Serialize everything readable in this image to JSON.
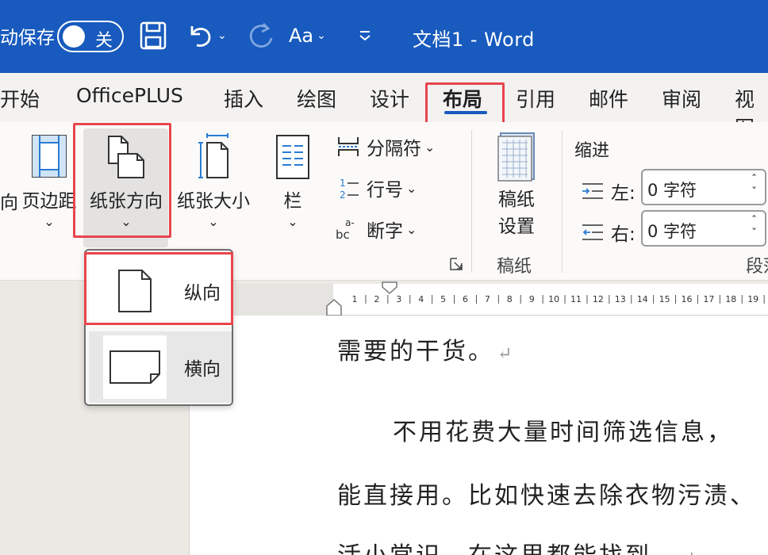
{
  "titlebar": {
    "autosave_label": "动保存",
    "autosave_state": "关",
    "font_button": "Aa",
    "doc_title": "文档1  -  Word"
  },
  "tabs": [
    {
      "label": "开始"
    },
    {
      "label": "OfficePLUS"
    },
    {
      "label": "插入"
    },
    {
      "label": "绘图"
    },
    {
      "label": "设计"
    },
    {
      "label": "布局"
    },
    {
      "label": "引用"
    },
    {
      "label": "邮件"
    },
    {
      "label": "审阅"
    },
    {
      "label": "视图"
    }
  ],
  "active_tab": "布局",
  "ribbon": {
    "left_cut": "向",
    "margins": "页边距",
    "orientation": "纸张方向",
    "size": "纸张大小",
    "columns": "栏",
    "breaks": "分隔符",
    "line_numbers": "行号",
    "hyphenation": "断字",
    "manuscript_line1": "稿纸",
    "manuscript_line2": "设置",
    "manuscript_group": "稿纸",
    "indent_title": "缩进",
    "indent_left_label": "左:",
    "indent_left_value": "0 字符",
    "indent_right_label": "右:",
    "indent_right_value": "0 字符",
    "paragraph_group": "段落"
  },
  "orientation_menu": {
    "portrait": "纵向",
    "landscape": "横向"
  },
  "ruler": {
    "ticks": [
      "1",
      "2",
      "3",
      "4",
      "5",
      "6",
      "7",
      "8",
      "9",
      "10",
      "11",
      "12",
      "13",
      "14",
      "15",
      "16",
      "17",
      "18",
      "19"
    ]
  },
  "document": {
    "line1": "需要的干货。",
    "line2": "不用花费大量时间筛选信息，",
    "line3": "能直接用。比如快速去除衣物污渍、",
    "line4": "活小常识，在这里都能找到。"
  },
  "colors": {
    "titlebar": "#185abd",
    "highlight": "#e8454d"
  }
}
